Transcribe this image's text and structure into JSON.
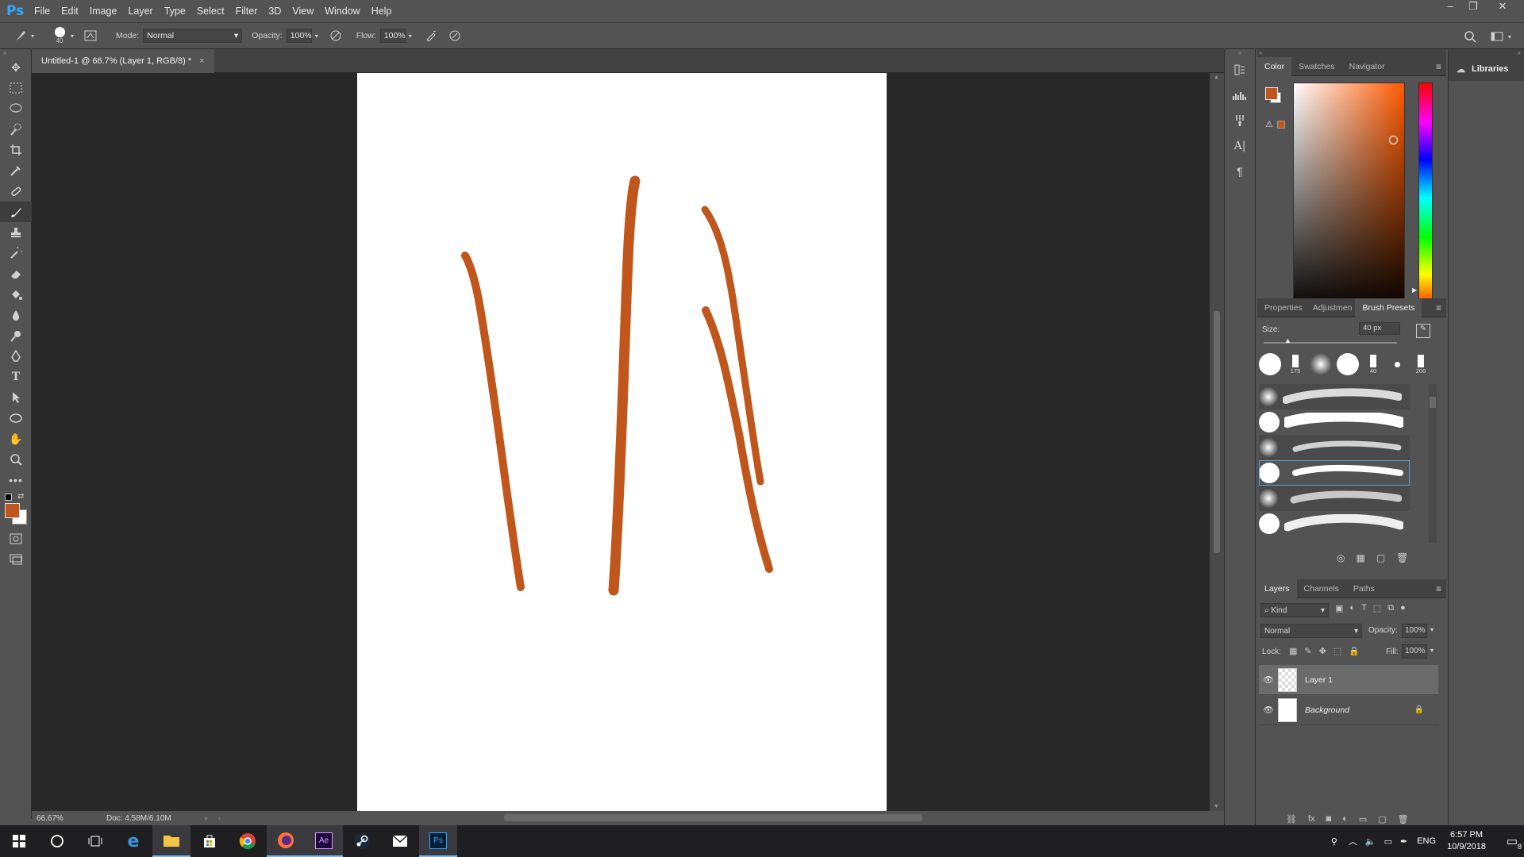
{
  "app": {
    "logo": "Ps",
    "menu": [
      "File",
      "Edit",
      "Image",
      "Layer",
      "Type",
      "Select",
      "Filter",
      "3D",
      "View",
      "Window",
      "Help"
    ]
  },
  "options": {
    "brush_size": "40",
    "mode_label": "Mode:",
    "mode_value": "Normal",
    "opacity_label": "Opacity:",
    "opacity_value": "100%",
    "flow_label": "Flow:",
    "flow_value": "100%"
  },
  "document": {
    "tab_title": "Untitled-1 @ 66.7% (Layer 1, RGB/8) *",
    "close": "×",
    "stroke_color": "#c0561b"
  },
  "status": {
    "zoom": "66.67%",
    "doc_size": "Doc: 4.58M/6.10M"
  },
  "color_panel": {
    "tabs": [
      "Color",
      "Swatches",
      "Navigator"
    ],
    "fg_color": "#c0561b",
    "bg_color": "#ffffff"
  },
  "brush_panel": {
    "tabs": [
      "Properties",
      "Adjustmen",
      "Brush Presets"
    ],
    "size_label": "Size:",
    "size_value": "40 px",
    "preset_numbers": [
      "175",
      "40",
      "200"
    ]
  },
  "layers_panel": {
    "tabs": [
      "Layers",
      "Channels",
      "Paths"
    ],
    "filter_kind": "Kind",
    "blend_mode": "Normal",
    "opacity_label": "Opacity:",
    "opacity_value": "100%",
    "lock_label": "Lock:",
    "fill_label": "Fill:",
    "fill_value": "100%",
    "layers": [
      {
        "name": "Layer 1"
      },
      {
        "name": "Background"
      }
    ]
  },
  "libraries": {
    "label": "Libraries"
  },
  "taskbar": {
    "lang": "ENG",
    "time": "6:57 PM",
    "date": "10/9/2018",
    "notifications": "8"
  }
}
